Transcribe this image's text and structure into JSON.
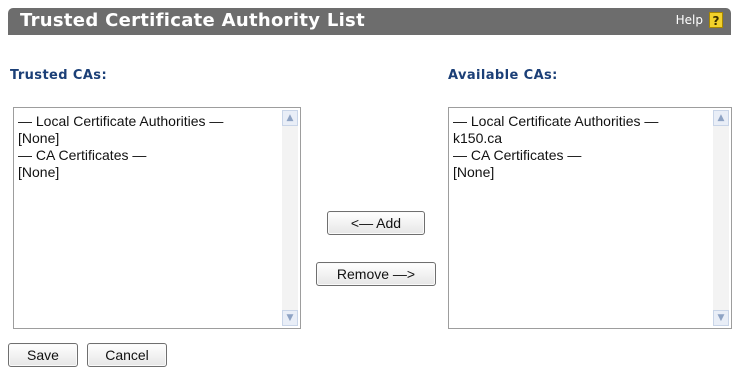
{
  "title": "Trusted Certificate Authority List",
  "help": {
    "label": "Help",
    "icon": "help-question-icon",
    "icon_glyph": "?"
  },
  "trusted": {
    "label": "Trusted CAs:",
    "items": [
      "— Local Certificate Authorities —",
      "[None]",
      "— CA Certificates —",
      "[None]"
    ]
  },
  "available": {
    "label": "Available CAs:",
    "items": [
      "— Local Certificate Authorities —",
      "k150.ca",
      "— CA Certificates —",
      "[None]"
    ]
  },
  "buttons": {
    "add": "<— Add",
    "remove": "Remove —>",
    "save": "Save",
    "cancel": "Cancel"
  },
  "colors": {
    "titlebar": "#6d6d6d",
    "label": "#1b3f77"
  }
}
